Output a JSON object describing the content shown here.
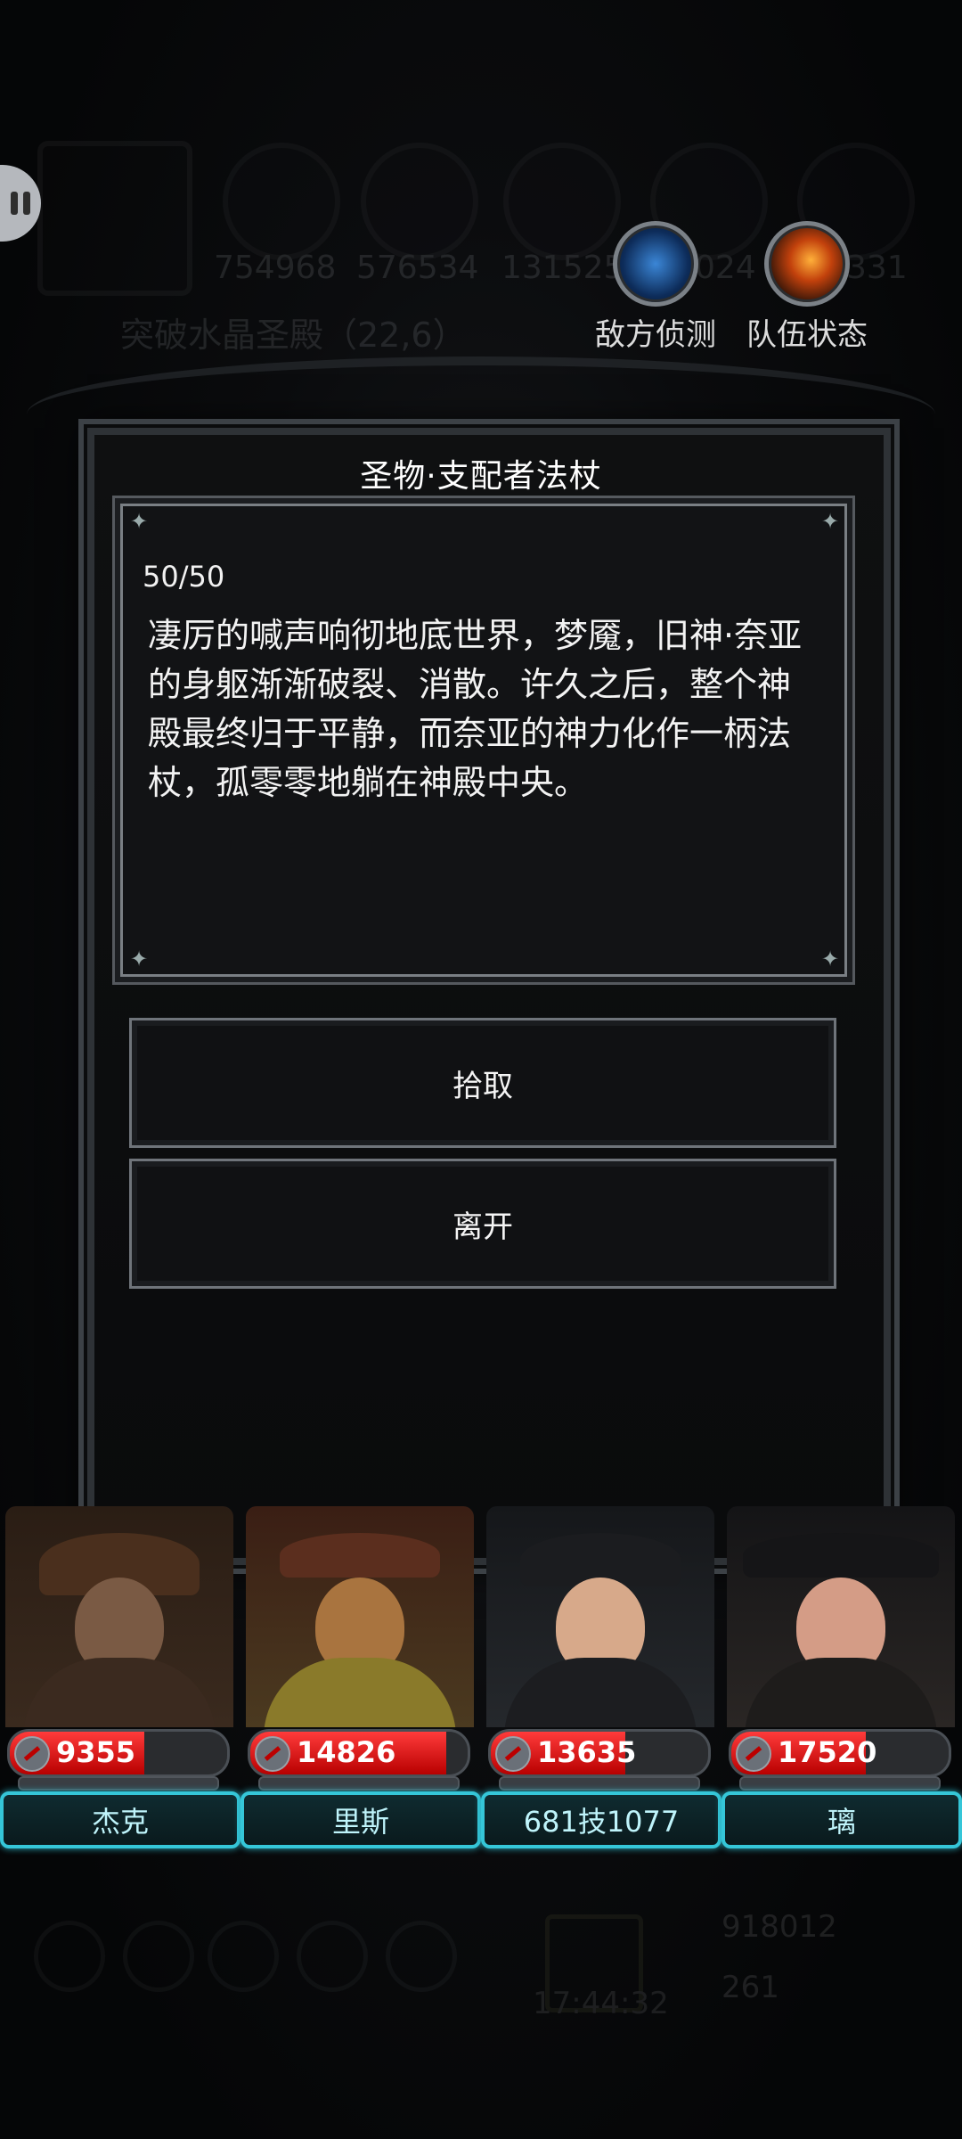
{
  "background_hud": {
    "resources": [
      "754968",
      "576534",
      "131525",
      "024",
      "331"
    ],
    "location": "突破水晶圣殿（22,6）",
    "time": "17:44:32",
    "gold": "918012",
    "gems": "261"
  },
  "hud_buttons": {
    "enemy_scout_label": "敌方侦测",
    "team_status_label": "队伍状态"
  },
  "dialog": {
    "title": "圣物·支配者法杖",
    "counter": "50/50",
    "story": "凄厉的喊声响彻地底世界，梦魇，旧神·奈亚的身躯渐渐破裂、消散。许久之后，整个神殿最终归于平静，而奈亚的神力化作一柄法杖，孤零零地躺在神殿中央。",
    "pickup_label": "拾取",
    "leave_label": "离开"
  },
  "heroes": [
    {
      "name": "杰克",
      "hp": "9355",
      "hp_fraction": 0.62
    },
    {
      "name": "里斯",
      "hp": "14826",
      "hp_fraction": 0.9
    },
    {
      "name": "681技1077",
      "hp": "13635",
      "hp_fraction": 0.62
    },
    {
      "name": "璃",
      "hp": "17520",
      "hp_fraction": 0.62
    }
  ],
  "colors": {
    "accent_cyan": "#35c6d8",
    "hp_red": "#e41414",
    "panel_border": "#7a7f84"
  }
}
